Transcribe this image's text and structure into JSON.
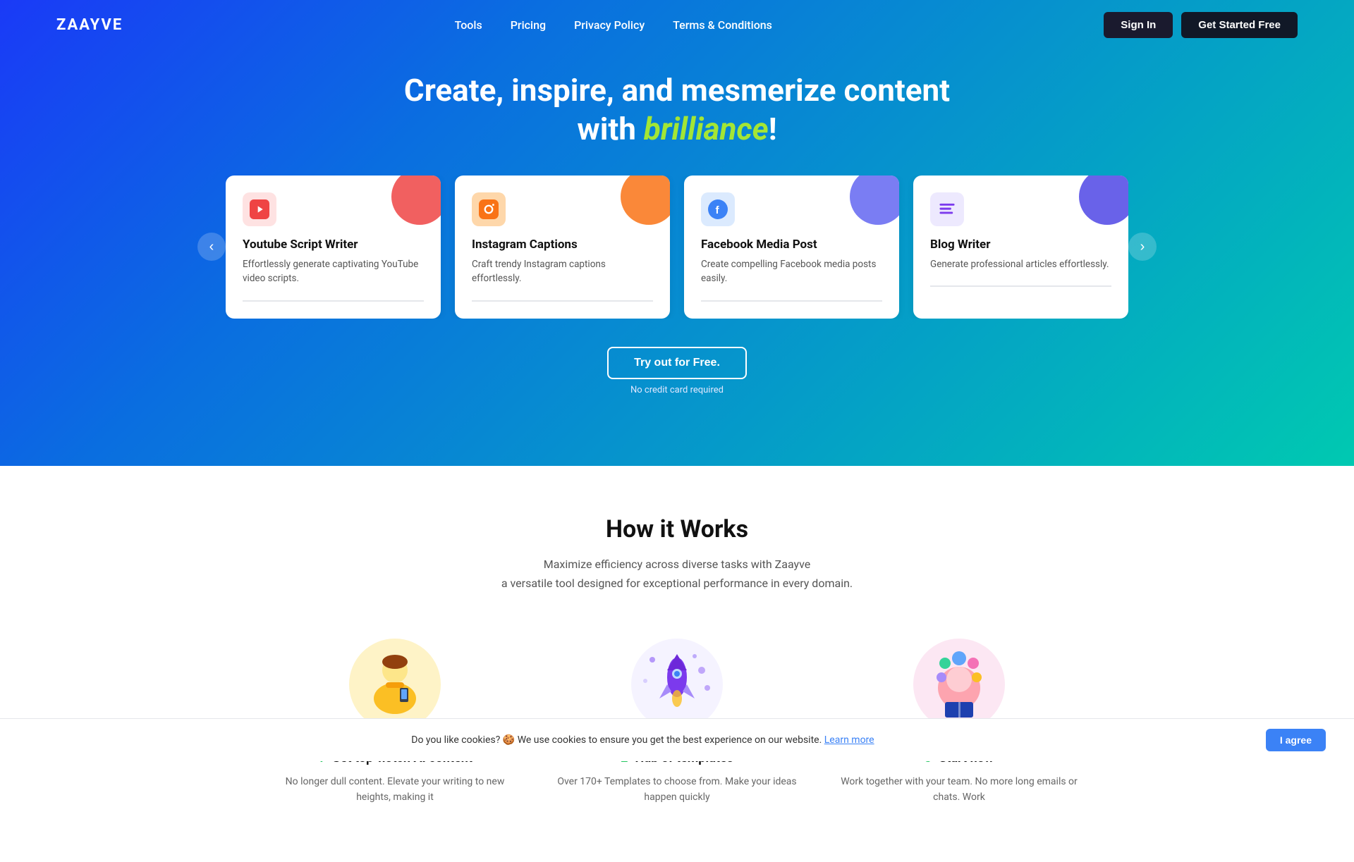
{
  "brand": {
    "logo": "ZAAYVE",
    "logo_accent": "="
  },
  "nav": {
    "items": [
      {
        "label": "Tools",
        "href": "#"
      },
      {
        "label": "Pricing",
        "href": "#"
      },
      {
        "label": "Privacy Policy",
        "href": "#"
      },
      {
        "label": "Terms & Conditions",
        "href": "#"
      }
    ]
  },
  "header": {
    "signin_label": "Sign In",
    "getstarted_label": "Get Started Free"
  },
  "hero": {
    "title_line1": "Create, inspire, and mesmerize content",
    "title_line2_prefix": "with ",
    "title_line2_highlight": "brilliance",
    "title_line2_suffix": "!"
  },
  "cards": [
    {
      "id": "youtube",
      "icon_unicode": "▶",
      "icon_bg": "#fee2e2",
      "icon_color": "#ef4444",
      "corner_color": "#ef4444",
      "title": "Youtube Script Writer",
      "desc": "Effortlessly generate captivating YouTube video scripts."
    },
    {
      "id": "instagram",
      "icon_unicode": "◎",
      "icon_bg": "#fed7aa",
      "icon_color": "#f97316",
      "corner_color": "#f97316",
      "title": "Instagram Captions",
      "desc": "Craft trendy Instagram captions effortlessly."
    },
    {
      "id": "facebook",
      "icon_unicode": "f",
      "icon_bg": "#dbeafe",
      "icon_color": "#3b82f6",
      "corner_color": "#6366f1",
      "title": "Facebook Media Post",
      "desc": "Create compelling Facebook media posts easily."
    },
    {
      "id": "blog",
      "icon_unicode": "≡",
      "icon_bg": "#ede9fe",
      "icon_color": "#7c3aed",
      "corner_color": "#4f46e5",
      "title": "Blog Writer",
      "desc": "Generate professional articles effortlessly."
    }
  ],
  "try_button": {
    "label": "Try out for Free.",
    "no_cc_text": "No credit card required"
  },
  "how_it_works": {
    "title": "How it Works",
    "desc_line1": "Maximize efficiency across diverse tasks with Zaayve",
    "desc_line2": "a versatile tool designed for exceptional performance in every domain.",
    "steps": [
      {
        "num": "1",
        "title": "Get top-notch AI content",
        "desc": "No longer dull content. Elevate your writing to new heights, making it"
      },
      {
        "num": "2",
        "title": "Hub of templates",
        "desc": "Over 170+ Templates to choose from. Make your ideas happen quickly"
      },
      {
        "num": "3",
        "title": "Start now",
        "desc": "Work together with your team. No more long emails or chats. Work"
      }
    ]
  },
  "cookie": {
    "text": "Do you like cookies? 🍪 We use cookies to ensure you get the best experience on our website.",
    "learn_more": "Learn more",
    "agree_label": "I agree"
  },
  "carousel": {
    "prev_label": "‹",
    "next_label": "›"
  }
}
